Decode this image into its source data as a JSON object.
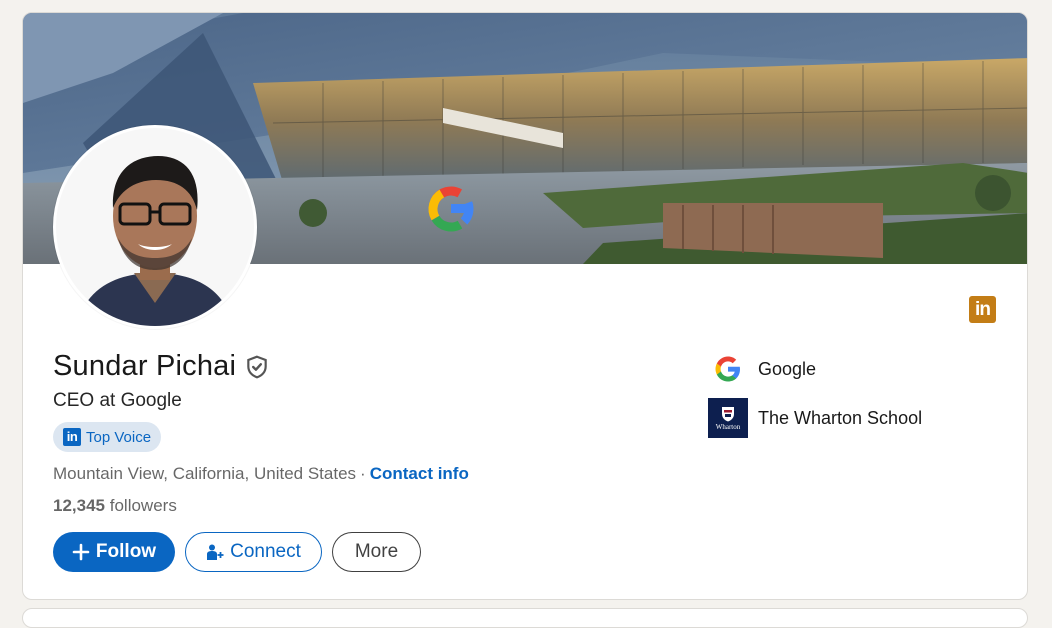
{
  "profile": {
    "name": "Sundar Pichai",
    "headline": "CEO at Google",
    "badge_label": "Top Voice",
    "location": "Mountain View, California, United States",
    "separator": "·",
    "contact_link": "Contact info",
    "followers_count": "12,345",
    "followers_label": "followers"
  },
  "actions": {
    "follow_label": "Follow",
    "connect_label": "Connect",
    "more_label": "More"
  },
  "organizations": [
    {
      "name": "Google",
      "logo": "google-logo"
    },
    {
      "name": "The Wharton School",
      "logo": "wharton-logo",
      "logo_text": "Wharton"
    }
  ],
  "icons": {
    "verified": "verified-shield-icon",
    "linkedin": "linkedin-logo-icon",
    "linkedin_glyph": "in",
    "plus": "plus-icon",
    "connect": "add-person-icon"
  },
  "colors": {
    "accent": "#0a66c2",
    "badge_bg": "#dce6f1",
    "linkedin_gold": "#c37d16",
    "page_bg": "#f4f2ee"
  }
}
